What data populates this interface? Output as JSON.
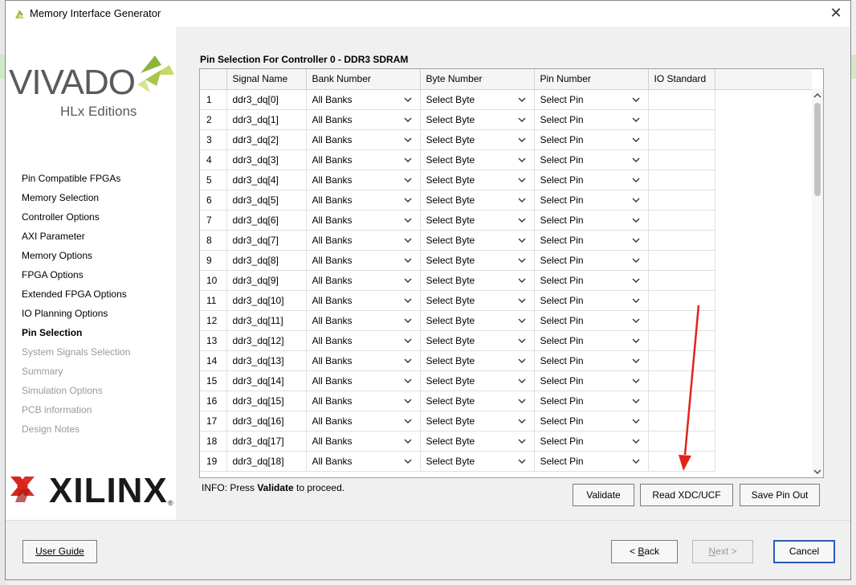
{
  "window": {
    "title": "Memory Interface Generator"
  },
  "sidebar": {
    "brand_top": "VIVADO",
    "brand_sub": "HLx Editions",
    "items": [
      {
        "label": "Pin Compatible FPGAs",
        "state": "normal"
      },
      {
        "label": "Memory Selection",
        "state": "normal"
      },
      {
        "label": "Controller Options",
        "state": "normal"
      },
      {
        "label": "AXI Parameter",
        "state": "normal"
      },
      {
        "label": "Memory Options",
        "state": "normal"
      },
      {
        "label": "FPGA Options",
        "state": "normal"
      },
      {
        "label": "Extended FPGA Options",
        "state": "normal"
      },
      {
        "label": "IO Planning Options",
        "state": "normal"
      },
      {
        "label": "Pin Selection",
        "state": "active"
      },
      {
        "label": "System Signals Selection",
        "state": "disabled"
      },
      {
        "label": "Summary",
        "state": "disabled"
      },
      {
        "label": "Simulation Options",
        "state": "disabled"
      },
      {
        "label": "PCB information",
        "state": "disabled"
      },
      {
        "label": "Design Notes",
        "state": "disabled"
      }
    ],
    "brand_bottom": "XILINX"
  },
  "main": {
    "section_title": "Pin Selection For Controller 0 - DDR3 SDRAM",
    "columns": [
      "",
      "Signal Name",
      "Bank Number",
      "Byte Number",
      "Pin Number",
      "IO Standard"
    ],
    "rows": [
      {
        "num": "1",
        "signal": "ddr3_dq[0]",
        "bank": "All Banks",
        "byte": "Select Byte",
        "pin": "Select Pin",
        "io": ""
      },
      {
        "num": "2",
        "signal": "ddr3_dq[1]",
        "bank": "All Banks",
        "byte": "Select Byte",
        "pin": "Select Pin",
        "io": ""
      },
      {
        "num": "3",
        "signal": "ddr3_dq[2]",
        "bank": "All Banks",
        "byte": "Select Byte",
        "pin": "Select Pin",
        "io": ""
      },
      {
        "num": "4",
        "signal": "ddr3_dq[3]",
        "bank": "All Banks",
        "byte": "Select Byte",
        "pin": "Select Pin",
        "io": ""
      },
      {
        "num": "5",
        "signal": "ddr3_dq[4]",
        "bank": "All Banks",
        "byte": "Select Byte",
        "pin": "Select Pin",
        "io": ""
      },
      {
        "num": "6",
        "signal": "ddr3_dq[5]",
        "bank": "All Banks",
        "byte": "Select Byte",
        "pin": "Select Pin",
        "io": ""
      },
      {
        "num": "7",
        "signal": "ddr3_dq[6]",
        "bank": "All Banks",
        "byte": "Select Byte",
        "pin": "Select Pin",
        "io": ""
      },
      {
        "num": "8",
        "signal": "ddr3_dq[7]",
        "bank": "All Banks",
        "byte": "Select Byte",
        "pin": "Select Pin",
        "io": ""
      },
      {
        "num": "9",
        "signal": "ddr3_dq[8]",
        "bank": "All Banks",
        "byte": "Select Byte",
        "pin": "Select Pin",
        "io": ""
      },
      {
        "num": "10",
        "signal": "ddr3_dq[9]",
        "bank": "All Banks",
        "byte": "Select Byte",
        "pin": "Select Pin",
        "io": ""
      },
      {
        "num": "11",
        "signal": "ddr3_dq[10]",
        "bank": "All Banks",
        "byte": "Select Byte",
        "pin": "Select Pin",
        "io": ""
      },
      {
        "num": "12",
        "signal": "ddr3_dq[11]",
        "bank": "All Banks",
        "byte": "Select Byte",
        "pin": "Select Pin",
        "io": ""
      },
      {
        "num": "13",
        "signal": "ddr3_dq[12]",
        "bank": "All Banks",
        "byte": "Select Byte",
        "pin": "Select Pin",
        "io": ""
      },
      {
        "num": "14",
        "signal": "ddr3_dq[13]",
        "bank": "All Banks",
        "byte": "Select Byte",
        "pin": "Select Pin",
        "io": ""
      },
      {
        "num": "15",
        "signal": "ddr3_dq[14]",
        "bank": "All Banks",
        "byte": "Select Byte",
        "pin": "Select Pin",
        "io": ""
      },
      {
        "num": "16",
        "signal": "ddr3_dq[15]",
        "bank": "All Banks",
        "byte": "Select Byte",
        "pin": "Select Pin",
        "io": ""
      },
      {
        "num": "17",
        "signal": "ddr3_dq[16]",
        "bank": "All Banks",
        "byte": "Select Byte",
        "pin": "Select Pin",
        "io": ""
      },
      {
        "num": "18",
        "signal": "ddr3_dq[17]",
        "bank": "All Banks",
        "byte": "Select Byte",
        "pin": "Select Pin",
        "io": ""
      },
      {
        "num": "19",
        "signal": "ddr3_dq[18]",
        "bank": "All Banks",
        "byte": "Select Byte",
        "pin": "Select Pin",
        "io": ""
      }
    ],
    "info_prefix": "INFO: Press ",
    "info_bold": "Validate",
    "info_suffix": " to proceed.",
    "buttons": {
      "validate": "Validate",
      "read_xdc": "Read XDC/UCF",
      "save_pin": "Save Pin Out"
    }
  },
  "footer": {
    "user_guide": "User Guide",
    "back_mnemonic": "B",
    "back_rest": "ack",
    "back_prefix": "< ",
    "next_mnemonic": "N",
    "next_rest": "ext",
    "next_suffix": " >",
    "cancel": "Cancel"
  },
  "colors": {
    "annotation_arrow": "#e0241b",
    "accent_border": "#2a5bb5",
    "xilinx_red": "#d9251d",
    "vivado_green": "#a8c64a"
  }
}
